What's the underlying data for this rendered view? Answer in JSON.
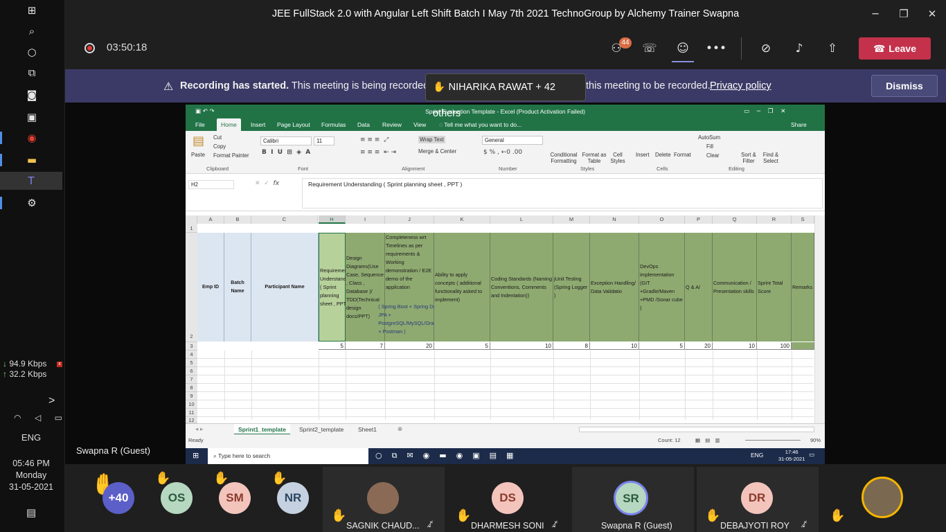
{
  "windows_taskbar": {
    "icons": [
      "windows-icon",
      "search-icon",
      "cortana-icon",
      "task-view-icon",
      "camera-icon",
      "photos-icon",
      "chrome-icon",
      "explorer-icon",
      "teams-icon",
      "settings-icon"
    ],
    "net_down": "94.9 Kbps",
    "net_up": "32.2 Kbps",
    "net_close": "x",
    "expand": ">",
    "lang": "ENG",
    "time": "05:46 PM",
    "day": "Monday",
    "date": "31-05-2021"
  },
  "window": {
    "title": "JEE FullStack 2.0 with Angular Left Shift Batch I May 7th 2021 TechnoGroup by Alchemy Trainer Swapna",
    "min": "─",
    "max": "❐",
    "close": "✕"
  },
  "meeting": {
    "timer": "03:50:18",
    "participants_badge": "44",
    "leave_label": "Leave"
  },
  "banner": {
    "bold": "Recording has started.",
    "text": "This meeting is being recorded.",
    "rest": "this meeting to be recorded.",
    "link": "Privacy policy",
    "dismiss": "Dismiss",
    "toast": "NIHARIKA RAWAT + 42 others"
  },
  "presenter": "Swapna R (Guest)",
  "excel": {
    "title": "Sprint Evaluation Template - Excel (Product Activation Failed)",
    "tabs": [
      "File",
      "Home",
      "Insert",
      "Page Layout",
      "Formulas",
      "Data",
      "Review",
      "View"
    ],
    "tell_me": "Tell me what you want to do...",
    "share": "Share",
    "ribbon": {
      "paste": "Paste",
      "cut": "Cut",
      "copy": "Copy",
      "format_painter": "Format Painter",
      "clipboard": "Clipboard",
      "font_name": "Calibri",
      "font_size": "11",
      "font": "Font",
      "wrap_text": "Wrap Text",
      "merge_center": "Merge & Center",
      "alignment": "Alignment",
      "number_format": "General",
      "number": "Number",
      "cond_fmt": "Conditional Formatting",
      "format_as_table": "Format as Table",
      "cell_styles": "Cell Styles",
      "styles": "Styles",
      "insert": "Insert",
      "delete": "Delete",
      "format": "Format",
      "cells": "Cells",
      "autosum": "AutoSum",
      "fill": "Fill",
      "clear": "Clear",
      "sort_filter": "Sort & Filter",
      "find_select": "Find & Select",
      "editing": "Editing"
    },
    "name_box": "H2",
    "formula": "Requirement Understanding ( Sprint planning sheet , PPT )",
    "columns": [
      "A",
      "B",
      "C",
      "H",
      "I",
      "J",
      "K",
      "L",
      "M",
      "N",
      "O",
      "P",
      "Q",
      "R",
      "S"
    ],
    "headers": [
      "Emp ID",
      "Batch Name",
      "Participant Name",
      "Requirement Understanding ( Sprint planning sheet , PPT )",
      "Design Diagrams(Use Case, Sequence , Class , Database )/ TDD(Technical design docs/PPT)",
      "Completeness wrt Timelines as per requirements & Working demonstration / E2E demo of the application",
      "Ability to apply concepts ( additional functionality asked to implement)",
      "Coding Standards (Naming Conventions, Comments and Indentation))",
      "jUnit Testing (Spring Logger )",
      "Exception Handling/ Data Validatio",
      "DevOps implementation (GIT +Gradle/Maven +PMD /Sonar cube )",
      "Q & A/",
      "Communication / Presentation skills",
      "Sprint Total Score",
      "Remarks"
    ],
    "j_tech": "( Spring Boot + Spring Data JPA + PostgreSQL/MySQL/Oracle + Postman )",
    "row3": [
      "5",
      "7",
      "20",
      "5",
      "10",
      "8",
      "10",
      "5",
      "20",
      "10",
      "100"
    ],
    "row_numbers": [
      "1",
      "2",
      "3",
      "4",
      "5",
      "6",
      "7",
      "8",
      "9",
      "10",
      "11",
      "12"
    ],
    "sheets": [
      "Sprint1_template",
      "Sprint2_template",
      "Sheet1"
    ],
    "status": "Ready",
    "count": "Count: 12",
    "zoom": "90%",
    "win_search": "Type here to search",
    "win_lang": "ENG",
    "win_time": "17:46",
    "win_date": "31-05-2021"
  },
  "participants": [
    {
      "initials": "+40",
      "color": "#5b5fc7"
    },
    {
      "initials": "OS",
      "color": "#b6d7c0"
    },
    {
      "initials": "SM",
      "color": "#f3c4bc"
    },
    {
      "initials": "NR",
      "color": "#c5d1e0"
    },
    {
      "initials": "",
      "name": "SAGNIK CHAUD...",
      "photo": "true"
    },
    {
      "initials": "DS",
      "name": "DHARMESH SONI",
      "color": "#f3c4bc"
    },
    {
      "initials": "SR",
      "name": "Swapna R (Guest)",
      "color": "#b6d7c0"
    },
    {
      "initials": "DR",
      "name": "DEBAJYOTI ROY",
      "color": "#f3c4bc"
    }
  ]
}
